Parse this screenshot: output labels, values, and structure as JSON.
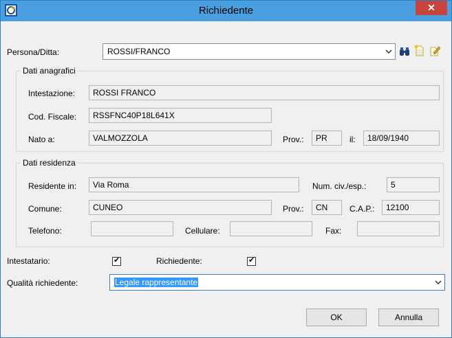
{
  "window": {
    "title": "Richiedente",
    "close_glyph": "✕"
  },
  "persona": {
    "label": "Persona/Ditta:",
    "value": "ROSSI/FRANCO"
  },
  "toolbar_icons": [
    "binoculars-icon",
    "new-document-icon",
    "edit-document-icon"
  ],
  "anagrafici": {
    "title": "Dati anagrafici",
    "intestazione_label": "Intestazione:",
    "intestazione_value": "ROSSI FRANCO",
    "codfiscale_label": "Cod. Fiscale:",
    "codfiscale_value": "RSSFNC40P18L641X",
    "nato_label": "Nato a:",
    "nato_value": "VALMOZZOLA",
    "prov_label": "Prov.:",
    "prov_value": "PR",
    "il_label": "il:",
    "il_value": "18/09/1940"
  },
  "residenza": {
    "title": "Dati residenza",
    "residente_label": "Residente in:",
    "residente_value": "Via Roma",
    "numciv_label": "Num. civ./esp.:",
    "numciv_value": "5",
    "comune_label": "Comune:",
    "comune_value": "CUNEO",
    "prov_label": "Prov.:",
    "prov_value": "CN",
    "cap_label": "C.A.P.:",
    "cap_value": "12100",
    "telefono_label": "Telefono:",
    "telefono_value": "",
    "cellulare_label": "Cellulare:",
    "cellulare_value": "",
    "fax_label": "Fax:",
    "fax_value": ""
  },
  "flags": {
    "intestatario_label": "Intestatario:",
    "intestatario_checked": true,
    "richiedente_label": "Richiedente:",
    "richiedente_checked": true,
    "check_glyph": "✔"
  },
  "qualita": {
    "label": "Qualità richiedente:",
    "value": "Legale rappresentante"
  },
  "buttons": {
    "ok": "OK",
    "annulla": "Annulla"
  },
  "colors": {
    "titlebar": "#4a9fe0",
    "close": "#c7453c",
    "selection": "#3399ff"
  }
}
